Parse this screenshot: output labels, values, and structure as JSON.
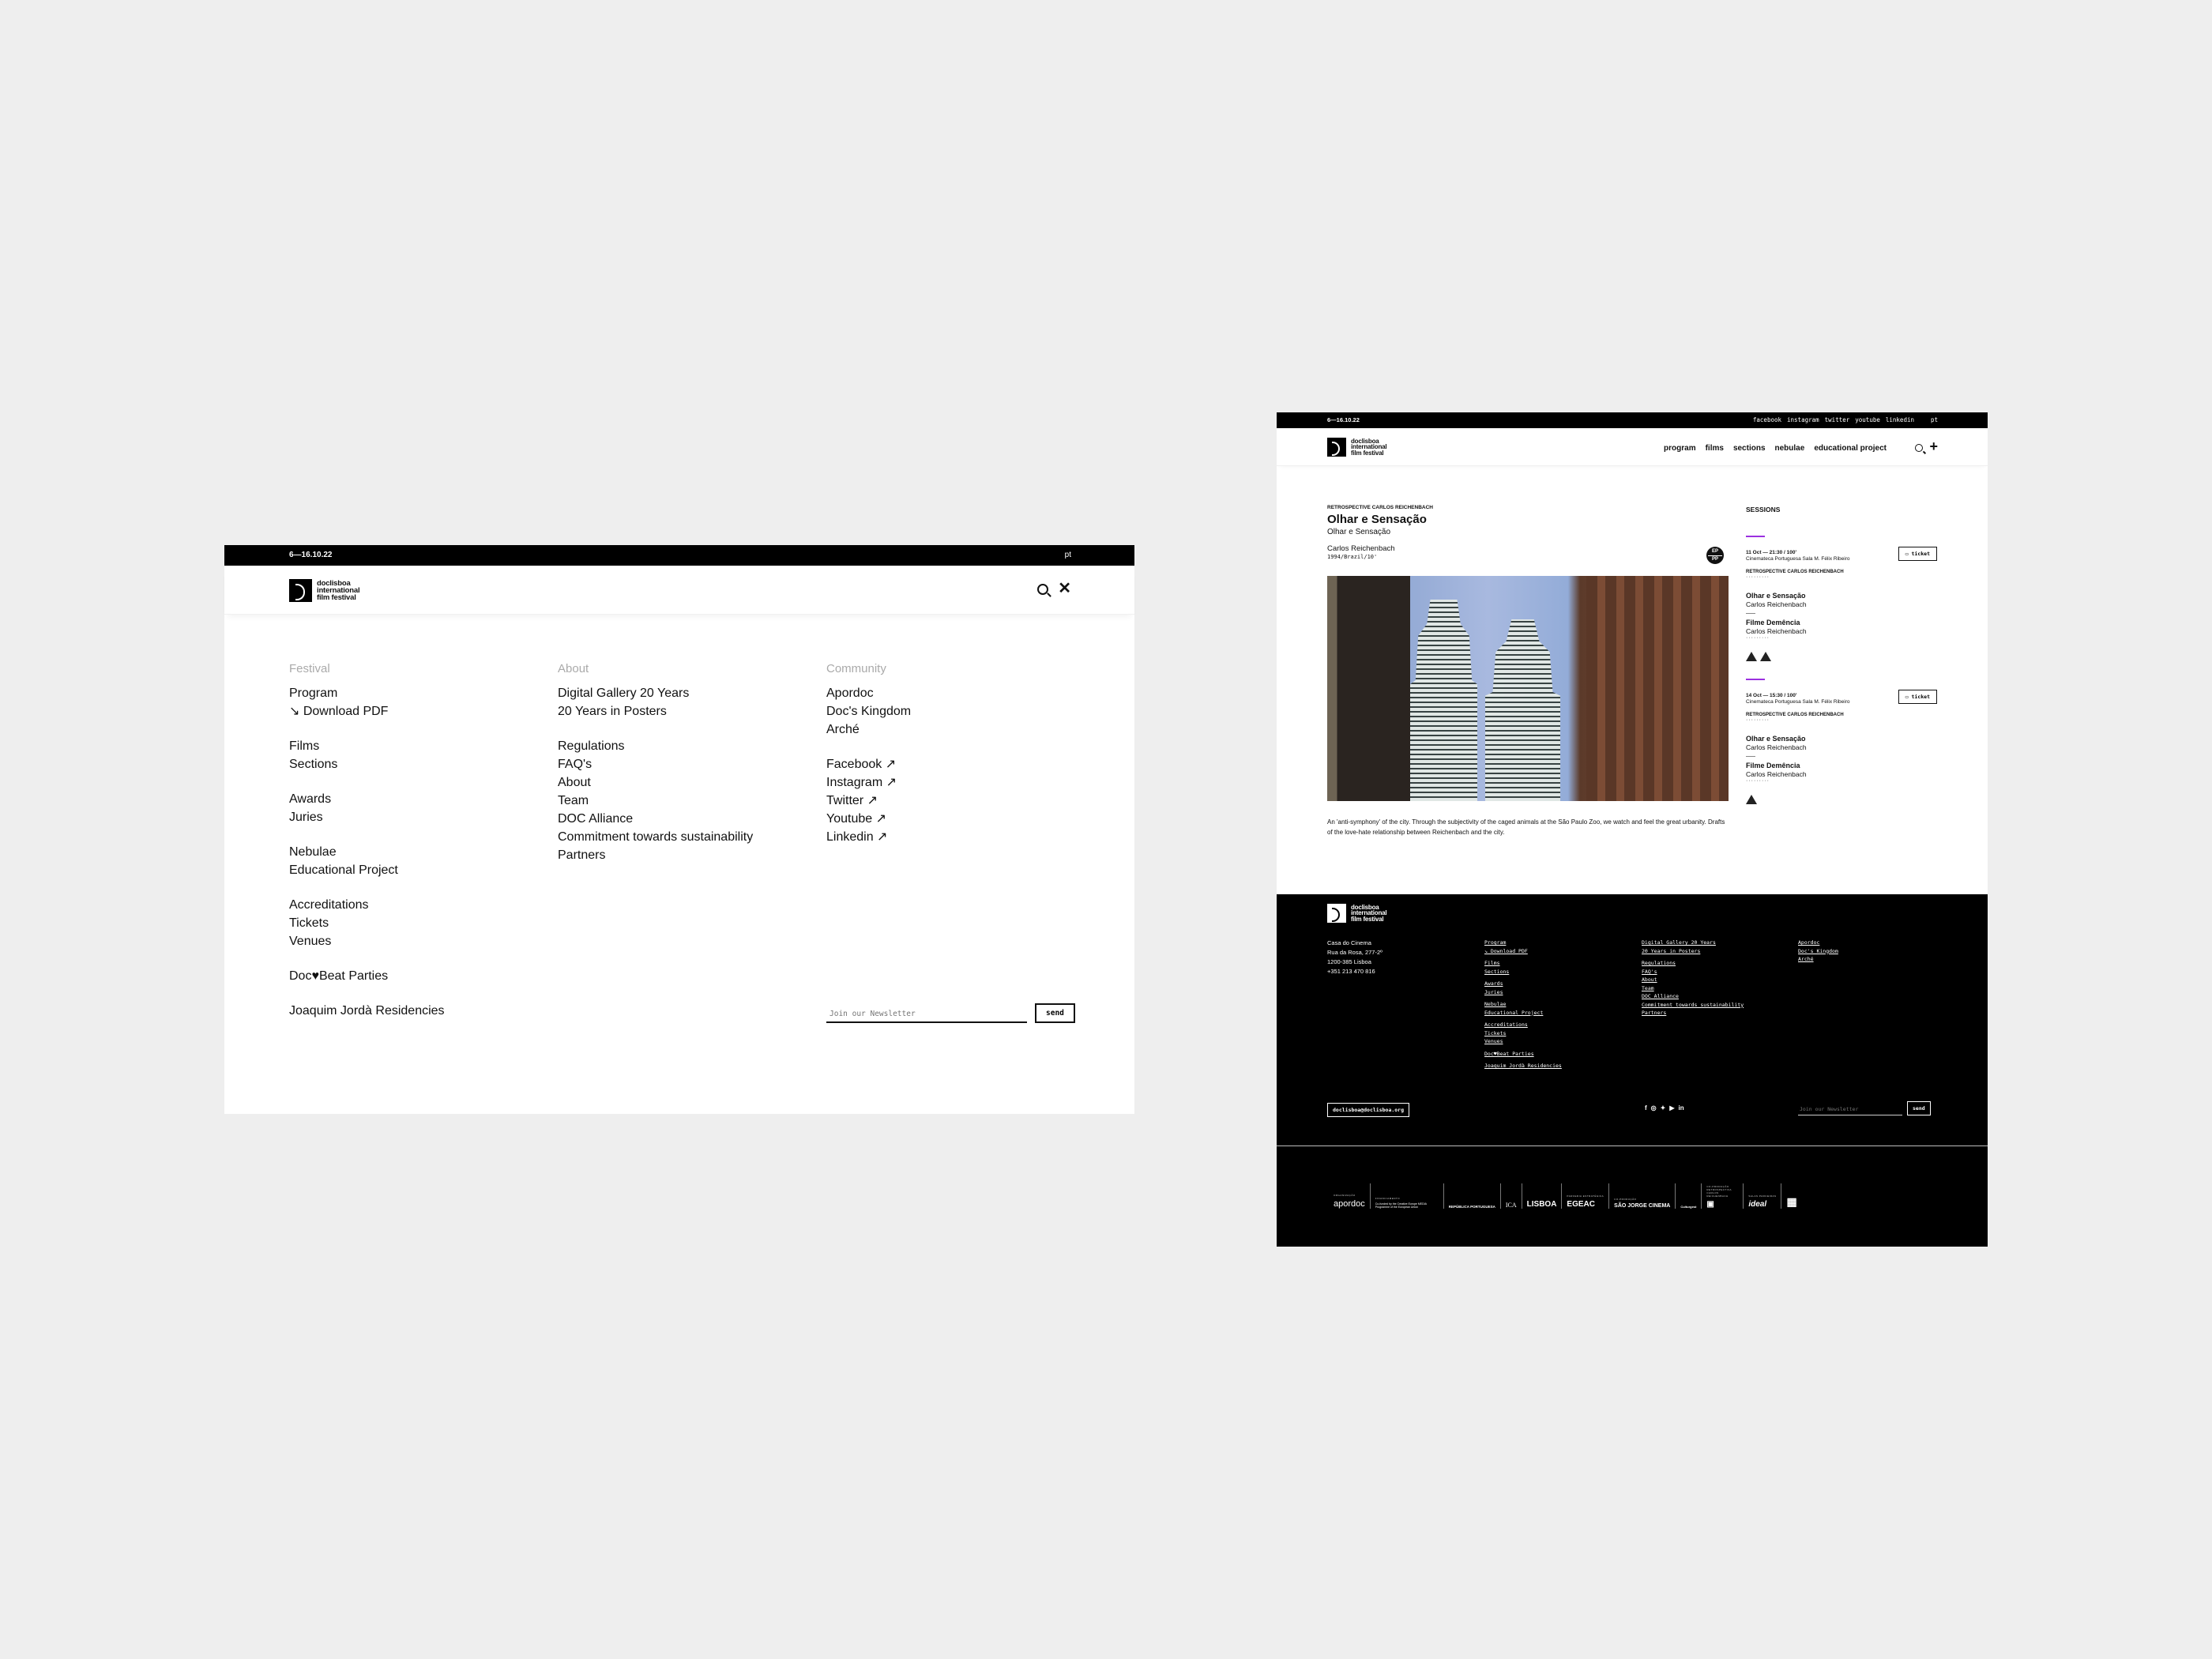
{
  "menu_page": {
    "topbar": {
      "dates": "6—16.10.22",
      "language": "pt"
    },
    "logo": {
      "line1": "doclisboa",
      "line2": "international",
      "line3": "film festival"
    },
    "columns": [
      {
        "heading": "Festival",
        "groups": [
          [
            "Program",
            "↘ Download PDF"
          ],
          [
            "Films",
            "Sections"
          ],
          [
            "Awards",
            "Juries"
          ],
          [
            "Nebulae",
            "Educational Project"
          ],
          [
            "Accreditations",
            "Tickets",
            "Venues"
          ],
          [
            "Doc♥Beat Parties"
          ],
          [
            "Joaquim Jordà Residencies"
          ]
        ]
      },
      {
        "heading": "About",
        "groups": [
          [
            "Digital Gallery 20 Years",
            "20 Years in Posters"
          ],
          [
            "Regulations",
            "FAQ's",
            "About",
            "Team",
            "DOC Alliance",
            "Commitment towards sustainability",
            "Partners"
          ]
        ]
      },
      {
        "heading": "Community",
        "groups": [
          [
            "Apordoc",
            "Doc's Kingdom",
            "Arché"
          ],
          [
            "Facebook ↗",
            "Instagram ↗",
            "Twitter ↗",
            "Youtube ↗",
            "Linkedin ↗"
          ]
        ]
      }
    ],
    "newsletter": {
      "placeholder": "Join our Newsletter",
      "button": "send"
    }
  },
  "film_page": {
    "topbar": {
      "dates": "6—16.10.22",
      "social": [
        "facebook",
        "instagram",
        "twitter",
        "youtube",
        "linkedin"
      ],
      "language": "pt"
    },
    "logo": {
      "line1": "doclisboa",
      "line2": "international",
      "line3": "film festival"
    },
    "nav": [
      "program",
      "films",
      "sections",
      "nebulae",
      "educational project"
    ],
    "film": {
      "section": "RETROSPECTIVE CARLOS REICHENBACH",
      "title": "Olhar e Sensação",
      "original_title": "Olhar e Sensação",
      "director": "Carlos Reichenbach",
      "meta": "1994/Brazil/10'",
      "badge_top": "EP",
      "badge_bottom": "PP",
      "synopsis": "An 'anti-symphony' of the city. Through the subjectivity of the caged animals at the São Paulo Zoo, we watch and feel the great urbanity. Drafts of the love-hate relationship between Reichenbach and the city."
    },
    "sessions": {
      "heading": "SESSIONS",
      "accent_color": "#9b30e0",
      "items": [
        {
          "when": "11 Oct — 21:30 / 100'",
          "venue": "Cinemateca Portuguesa Sala M. Félix Ribeiro",
          "ticket": "ticket",
          "section": "RETROSPECTIVE CARLOS REICHENBACH",
          "dots": "·········",
          "films": [
            {
              "title": "Olhar e Sensação",
              "director": "Carlos Reichenbach"
            },
            {
              "title": "Filme Demência",
              "director": "Carlos Reichenbach"
            }
          ],
          "ratings": [
            "rating-icon",
            "rating-icon"
          ]
        },
        {
          "when": "14 Oct — 15:30 / 100'",
          "venue": "Cinemateca Portuguesa Sala M. Félix Ribeiro",
          "ticket": "ticket",
          "section": "RETROSPECTIVE CARLOS REICHENBACH",
          "dots": "·········",
          "films": [
            {
              "title": "Olhar e Sensação",
              "director": "Carlos Reichenbach"
            },
            {
              "title": "Filme Demência",
              "director": "Carlos Reichenbach"
            }
          ],
          "ratings": [
            "rating-icon"
          ]
        }
      ]
    },
    "footer": {
      "address": [
        "Casa do Cinema",
        "Rua da Rosa, 277-2º",
        "1200-385 Lisboa",
        "+351 213 470 816"
      ],
      "col1": [
        [
          "Program",
          "↘ Download PDF"
        ],
        [
          "Films",
          "Sections"
        ],
        [
          "Awards",
          "Juries"
        ],
        [
          "Nebulae",
          "Educational Project"
        ],
        [
          "Accreditations",
          "Tickets",
          "Venues"
        ],
        [
          "Doc♥Beat Parties"
        ],
        [
          "Joaquim Jordà Residencies"
        ]
      ],
      "col2": [
        [
          "Digital Gallery 20 Years",
          "20 Years in Posters"
        ],
        [
          "Regulations",
          "FAQ's",
          "About",
          "Team",
          "DOC Alliance",
          "Commitment towards sustainability",
          "Partners"
        ]
      ],
      "col3": [
        [
          "Apordoc",
          "Doc's Kingdom",
          "Arché"
        ]
      ],
      "email": "doclisboa@doclisboa.org",
      "social_icons": [
        "f",
        "◎",
        "🐦",
        "▶",
        "in"
      ],
      "newsletter": {
        "placeholder": "Join our Newsletter",
        "button": "send"
      },
      "partners": [
        {
          "caption": "ORGANIZAÇÃO",
          "name": "apordoc"
        },
        {
          "caption": "FINANCIAMENTO",
          "name": "Co-funded by the Creative Europe MEDIA Programme of the European Union"
        },
        {
          "caption": "",
          "name": "REPÚBLICA PORTUGUESA"
        },
        {
          "caption": "",
          "name": "ICA"
        },
        {
          "caption": "",
          "name": "LISBOA"
        },
        {
          "caption": "PARCERIA ESTRATÉGICA",
          "name": "EGEAC"
        },
        {
          "caption": "CO-PRODUÇÃO",
          "name": "SÃO JORGE CINEMA"
        },
        {
          "caption": "",
          "name": "Culturgest"
        },
        {
          "caption": "CO-PRODUÇÃO RETROSPECTIVA CARLOS REICHENBACH",
          "name": "▣"
        },
        {
          "caption": "SALAS PARCEIRAS",
          "name": "ideal"
        },
        {
          "caption": "",
          "name": "▦"
        }
      ]
    }
  }
}
